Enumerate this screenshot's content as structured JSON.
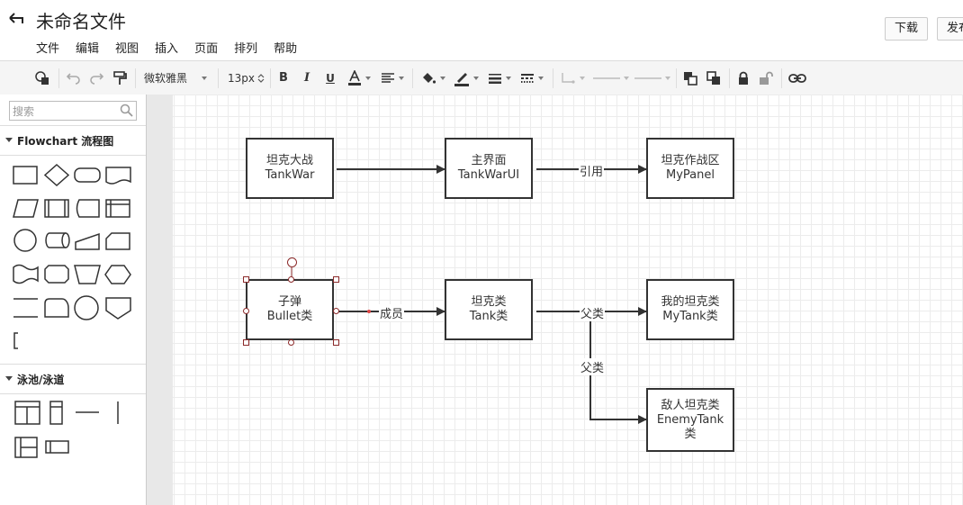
{
  "header": {
    "title": "未命名文件",
    "menu": [
      "文件",
      "编辑",
      "视图",
      "插入",
      "页面",
      "排列",
      "帮助"
    ],
    "download_label": "下载",
    "publish_label": "发布"
  },
  "toolbar": {
    "font_family": "微软雅黑",
    "font_size": "13px"
  },
  "sidebar": {
    "search_placeholder": "搜索",
    "sections": [
      {
        "label": "Flowchart 流程图"
      },
      {
        "label": "泳池/泳道"
      }
    ]
  },
  "diagram": {
    "nodes": [
      {
        "line1": "坦克大战",
        "line2": "TankWar"
      },
      {
        "line1": "主界面",
        "line2": "TankWarUI"
      },
      {
        "line1": "坦克作战区",
        "line2": "MyPanel"
      },
      {
        "line1": "子弹",
        "line2": "Bullet类"
      },
      {
        "line1": "坦克类",
        "line2": "Tank类"
      },
      {
        "line1": "我的坦克类",
        "line2": "MyTank类"
      },
      {
        "line1": "敌人坦克类",
        "line2": "EnemyTank",
        "line3": "类"
      }
    ],
    "edge_labels": [
      "引用",
      "成员",
      "父类",
      "父类"
    ]
  },
  "colors": {
    "accent_selection": "#8b2a2a",
    "node_border": "#333333",
    "toolbar_bg": "#f5f5f5"
  }
}
